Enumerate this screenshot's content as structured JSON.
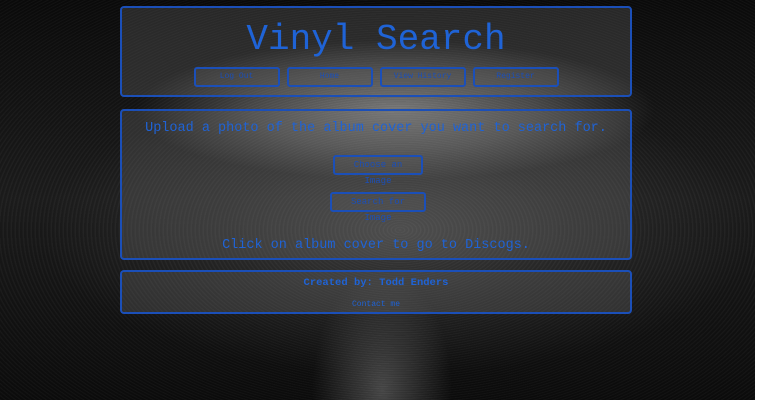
{
  "header": {
    "title": "Vinyl Search",
    "nav": [
      "Log Out",
      "Home",
      "View History",
      "Register"
    ]
  },
  "main": {
    "upload_prompt": "Upload a photo of the album cover you want to search for.",
    "choose_button": "Choose an Image",
    "search_button": "Search for Image",
    "discogs_hint": "Click on album cover to go to Discogs."
  },
  "footer": {
    "created_by": "Created by: Todd Enders",
    "contact": "Contact me"
  },
  "colors": {
    "accent": "#1f63d6",
    "border": "#1b4fb8",
    "background": "#000000"
  }
}
